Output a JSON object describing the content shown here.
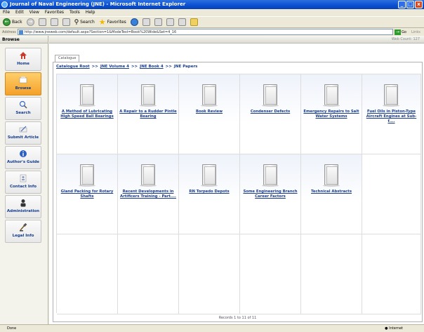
{
  "window": {
    "title": "Journal of Naval Engineering (JNE) - Microsoft Internet Explorer",
    "buttons": [
      "_",
      "□",
      "x"
    ]
  },
  "menu": [
    "File",
    "Edit",
    "View",
    "Favorites",
    "Tools",
    "Help"
  ],
  "toolbar": {
    "back_label": "Back",
    "search_label": "Search",
    "favorites_label": "Favorites"
  },
  "address": {
    "label": "Address",
    "url": "http://www.jneweb.com/default.aspx?Section=1&ModeTest=Book%20Wide&Set=4_16",
    "go_label": "Go",
    "links_label": "Links"
  },
  "sidebar": {
    "header": "Browse",
    "items": [
      {
        "label": "Home",
        "icon": "home-icon"
      },
      {
        "label": "Browse",
        "icon": "browse-icon",
        "active": true
      },
      {
        "label": "Search",
        "icon": "search-icon"
      },
      {
        "label": "Submit Article",
        "icon": "submit-icon"
      },
      {
        "label": "Author's Guide",
        "icon": "info-icon"
      },
      {
        "label": "Contact Info",
        "icon": "contact-icon"
      },
      {
        "label": "Administration",
        "icon": "admin-icon"
      },
      {
        "label": "Legal Info",
        "icon": "legal-icon"
      }
    ]
  },
  "main": {
    "web_count": "Web Count: 127",
    "tab": "Catalogue",
    "breadcrumb": [
      "Catalogue Root",
      "JNE Volume 4",
      "JNE Book 4",
      "JNE Papers"
    ],
    "items": [
      "A Method of Lubricating High Speed Ball Bearings",
      "A Repair to a Rudder Pintle Bearing",
      "Book Review",
      "Condenser Defects",
      "Emergency Repairs to Salt Water Systems",
      "Fuel Oils in Piston-Type Aircraft Engines at Sub-f....",
      "Gland Packing for Rotary Shafts",
      "Recent Developments in Artificers Training - Part....",
      "RN Torpedo Depots",
      "Some Engineering Branch Career Factors",
      "Technical Abstracts"
    ],
    "records": "Records 1 to 11 of 11"
  },
  "status": {
    "left": "Done",
    "zone": "Internet"
  }
}
